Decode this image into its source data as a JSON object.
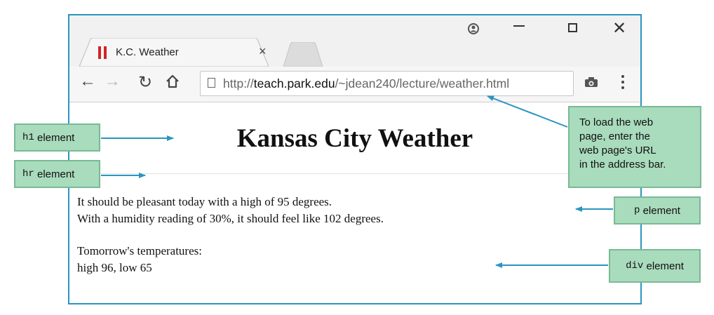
{
  "browser": {
    "tab_title": "K.C. Weather",
    "tab_close": "×",
    "url_prefix": "http://",
    "url_host": "teach.park.edu",
    "url_path": "/~jdean240/lecture/weather.html",
    "icons": [
      "favicon-icon",
      "tab-close-icon",
      "account-icon",
      "minimize-icon",
      "maximize-icon",
      "close-icon",
      "back-arrow-icon",
      "forward-arrow-icon",
      "reload-icon",
      "home-icon",
      "page-icon",
      "camera-icon",
      "menu-icon"
    ],
    "colors": {
      "frame": "#2b95c0",
      "favicon": "#d12424"
    }
  },
  "page": {
    "heading": "Kansas City Weather",
    "paragraph_line1": "It should be pleasant today with a high of 95 degrees.",
    "paragraph_line2": "With a humidity reading of 30%, it should feel like 102 degrees.",
    "div_line1": "Tomorrow's temperatures:",
    "div_line2": "high 96, low 65"
  },
  "callouts": {
    "h1_code": "h1",
    "h1_text": "element",
    "hr_code": "hr",
    "hr_text": "element",
    "p_code": "p",
    "p_text": "element",
    "div_code": "div",
    "div_text": "element",
    "url_line1": "To load the web",
    "url_line2": "page, enter the",
    "url_line3": "web page's URL",
    "url_line4": "in the address bar.",
    "colors": {
      "fill": "#a9dbbd",
      "border": "#78ba94",
      "arrow": "#2b95c0"
    }
  }
}
